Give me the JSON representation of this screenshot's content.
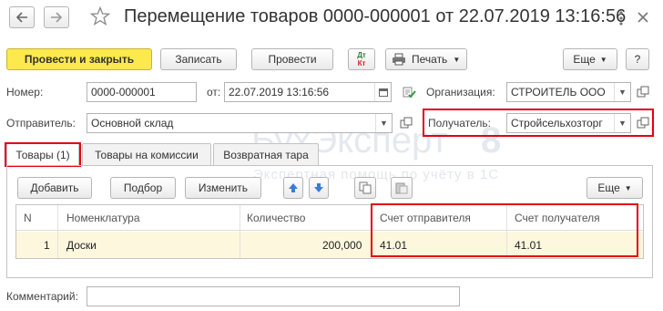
{
  "window": {
    "title": "Перемещение товаров 0000-000001 от 22.07.2019 13:16:56",
    "back_icon": "arrow-left",
    "forward_icon": "arrow-right",
    "favorite_icon": "star-outline",
    "more_icon": "vertical-ellipsis",
    "close_icon": "close-x"
  },
  "toolbar": {
    "post_close": "Провести и закрыть",
    "save": "Записать",
    "post": "Провести",
    "dtkt_top": "Дт",
    "dtkt_bottom": "Кт",
    "print": "Печать",
    "more": "Еще",
    "help": "?"
  },
  "form": {
    "number_label": "Номер:",
    "number_value": "0000-000001",
    "date_label": "от:",
    "date_value": "22.07.2019 13:16:56",
    "org_label": "Организация:",
    "org_value": "СТРОИТЕЛЬ ООО",
    "sender_label": "Отправитель:",
    "sender_value": "Основной склад",
    "receiver_label": "Получатель:",
    "receiver_value": "Стройсельхозторг",
    "comment_label": "Комментарий:",
    "comment_value": ""
  },
  "tabs": [
    {
      "label": "Товары (1)"
    },
    {
      "label": "Товары на комиссии"
    },
    {
      "label": "Возвратная тара"
    }
  ],
  "table_toolbar": {
    "add": "Добавить",
    "select": "Подбор",
    "change": "Изменить",
    "more": "Еще"
  },
  "table": {
    "columns": [
      "N",
      "Номенклатура",
      "Количество",
      "Счет отправителя",
      "Счет получателя"
    ],
    "rows": [
      {
        "n": "1",
        "item": "Доски",
        "qty": "200,000",
        "sender_account": "41.01",
        "receiver_account": "41.01"
      }
    ]
  },
  "watermark": {
    "brand": "БухЭксперт",
    "digit": "8",
    "tagline": "Экспертная помощь по учёту в 1С"
  },
  "colors": {
    "primary_button": "#fbe94d",
    "highlight_red": "#e3000f",
    "selected_row": "#fdf6d8",
    "watermark": "#cfd8e2"
  }
}
